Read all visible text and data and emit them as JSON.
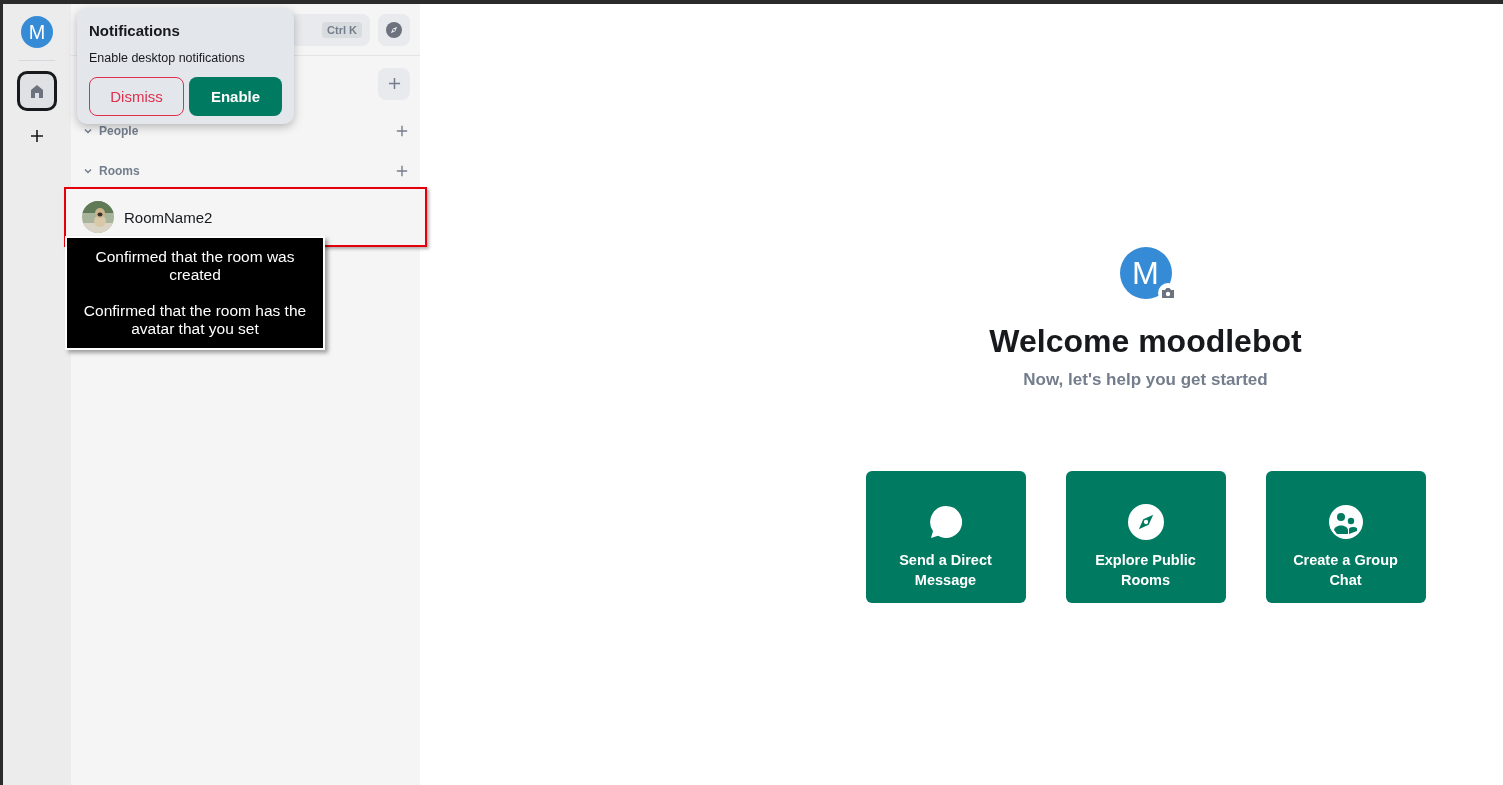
{
  "space_bar": {
    "avatar_letter": "M",
    "items": [
      {
        "kind": "home",
        "selected": true
      },
      {
        "kind": "add",
        "selected": false
      }
    ]
  },
  "room_list": {
    "search_shortcut": "Ctrl K",
    "sections": [
      {
        "label": "People",
        "expanded": true
      },
      {
        "label": "Rooms",
        "expanded": true,
        "rooms": [
          {
            "name": "RoomName2",
            "highlighted": true
          }
        ]
      }
    ]
  },
  "notification_toast": {
    "title": "Notifications",
    "description": "Enable desktop notifications",
    "dismiss": "Dismiss",
    "enable": "Enable"
  },
  "annotation": {
    "paragraphs": [
      "Confirmed that the room was created",
      "Confirmed that the room has the avatar that you set"
    ]
  },
  "welcome": {
    "avatar_letter": "M",
    "title": "Welcome moodlebot",
    "subtitle": "Now, let's help you get started",
    "actions": [
      {
        "kind": "message",
        "label": "Send a Direct Message"
      },
      {
        "kind": "explore",
        "label": "Explore Public Rooms"
      },
      {
        "kind": "group",
        "label": "Create a Group Chat"
      }
    ]
  }
}
